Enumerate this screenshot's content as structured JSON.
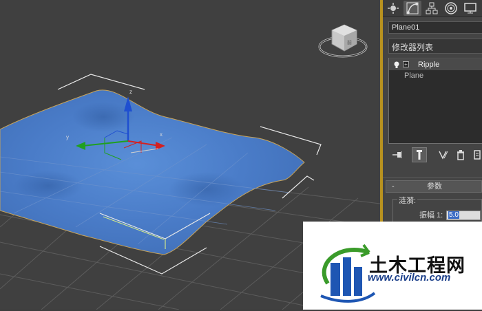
{
  "object_name": "Plane01",
  "modifier_list_label": "修改器列表",
  "modifier_stack": [
    {
      "name": "Ripple",
      "selected": true
    },
    {
      "name": "Plane",
      "selected": false
    }
  ],
  "tabs": [
    "create-tab",
    "modify-tab",
    "hierarchy-tab",
    "motion-tab",
    "display-tab"
  ],
  "rollout": {
    "collapse_symbol": "-",
    "title": "参数",
    "group_label": "涟漪:",
    "amplitude_label": "振幅 1:",
    "amplitude_value": "5.0"
  },
  "gizmo_axis_labels": {
    "x": "x",
    "y": "y",
    "z": "z"
  },
  "viewcube_label": "前",
  "watermark": {
    "title": "土木工程网",
    "url": "www.civilcn.com"
  },
  "colors": {
    "plane": "#4a7cc8",
    "panel_bg": "#444444",
    "viewport_bg": "#404040",
    "divider": "#b8921f",
    "x_axis": "#d42020",
    "y_axis": "#20a020",
    "z_axis": "#1f4fd0"
  }
}
